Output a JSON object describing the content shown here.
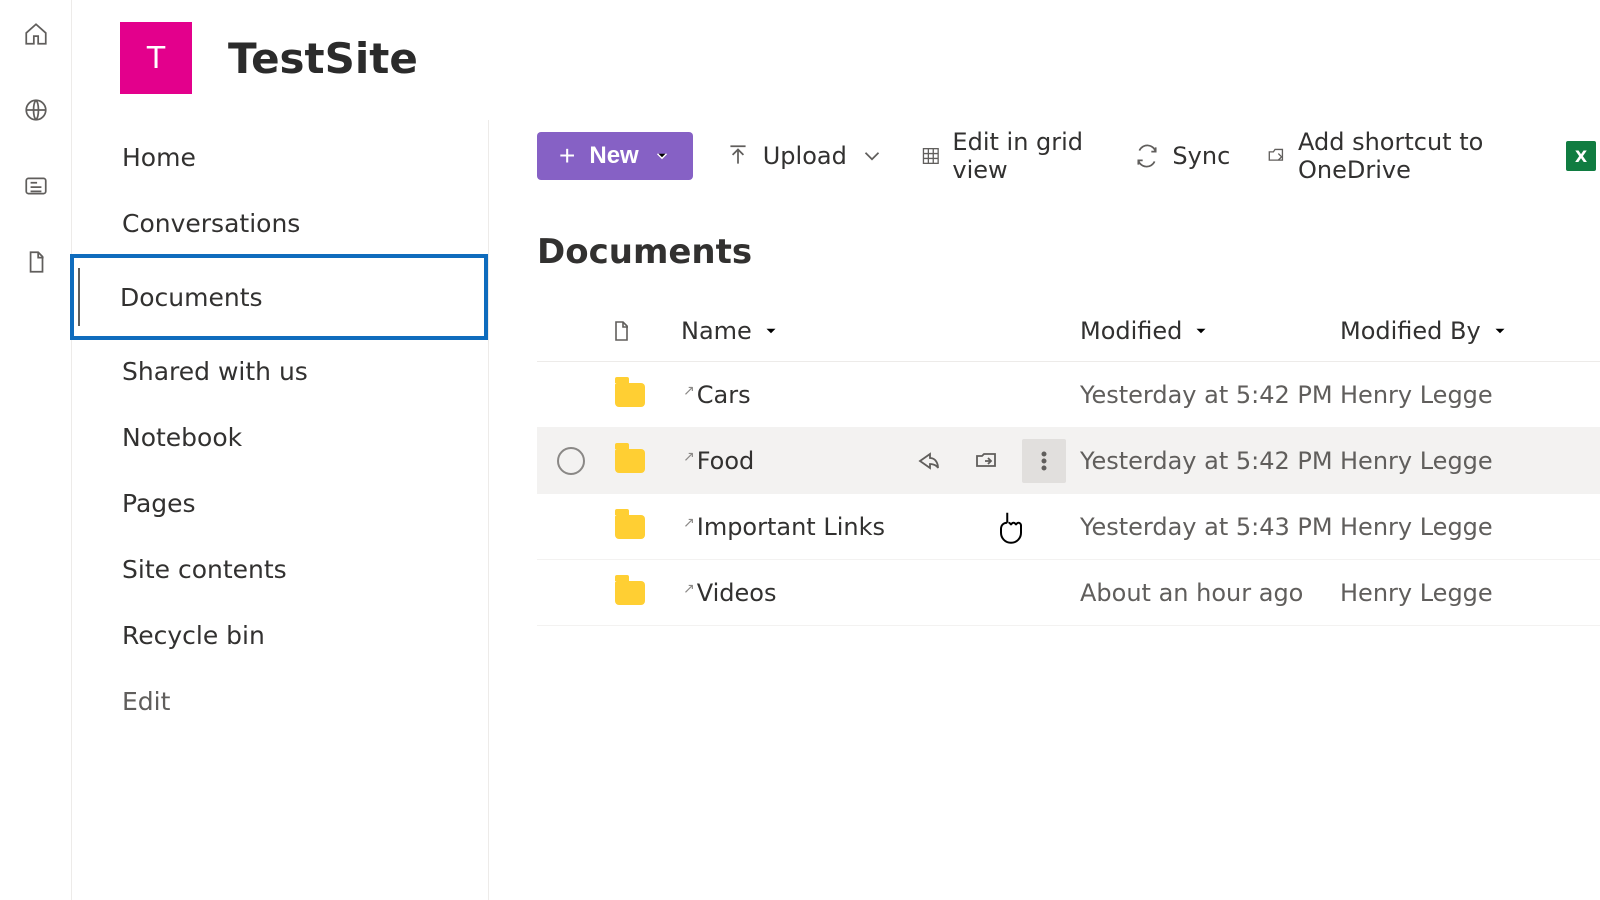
{
  "site": {
    "tile_letter": "T",
    "title": "TestSite"
  },
  "nav": {
    "items": [
      {
        "label": "Home"
      },
      {
        "label": "Conversations"
      },
      {
        "label": "Documents"
      },
      {
        "label": "Shared with us"
      },
      {
        "label": "Notebook"
      },
      {
        "label": "Pages"
      },
      {
        "label": "Site contents"
      },
      {
        "label": "Recycle bin"
      }
    ],
    "edit_label": "Edit",
    "selected_index": 2
  },
  "toolbar": {
    "new_label": "New",
    "upload_label": "Upload",
    "grid_label": "Edit in grid view",
    "sync_label": "Sync",
    "shortcut_label": "Add shortcut to OneDrive",
    "excel_letter": "X"
  },
  "library": {
    "title": "Documents",
    "columns": {
      "name": "Name",
      "modified": "Modified",
      "modified_by": "Modified By"
    },
    "rows": [
      {
        "name": "Cars",
        "modified": "Yesterday at 5:42 PM",
        "modified_by": "Henry Legge"
      },
      {
        "name": "Food",
        "modified": "Yesterday at 5:42 PM",
        "modified_by": "Henry Legge"
      },
      {
        "name": "Important Links",
        "modified": "Yesterday at 5:43 PM",
        "modified_by": "Henry Legge"
      },
      {
        "name": "Videos",
        "modified": "About an hour ago",
        "modified_by": "Henry Legge"
      }
    ],
    "hovered_index": 1
  }
}
